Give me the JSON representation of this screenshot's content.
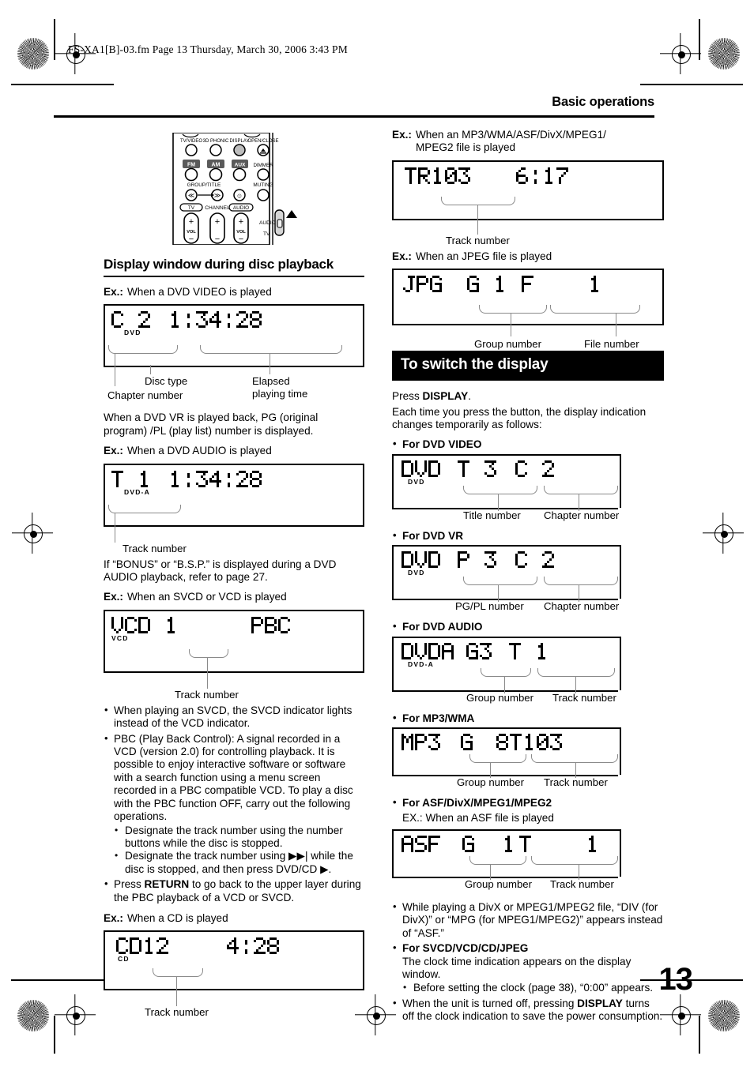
{
  "header": {
    "file_stamp": "FS-XA1[B]-03.fm  Page 13  Thursday, March 30, 2006  3:43 PM",
    "running_head": "Basic operations",
    "page_number": "13"
  },
  "remote": {
    "labels": [
      "TV/VIDEO",
      "3D PHONIC",
      "DISPLAY",
      "OPEN/CLOSE",
      "FM",
      "AM",
      "AUX",
      "DIMMER",
      "GROUP/TITLE",
      "MUTING",
      "TV",
      "CHANNEL",
      "AUDIO",
      "VOL",
      "VOL",
      "AUDIO",
      "TV"
    ]
  },
  "left": {
    "section_title": "Display window during disc playback",
    "ex_dvd_video": {
      "label": "Ex.:",
      "text": "When a DVD VIDEO is played"
    },
    "lcd_dvd_video": {
      "left_text": "C 2",
      "right_text": "1:34:28",
      "indicator": "DVD",
      "captions": [
        "Disc type",
        "Chapter number",
        "Elapsed",
        "playing time"
      ]
    },
    "para_dvdvr": "When a DVD VR is played back, PG (original program) /PL (play list) number is displayed.",
    "ex_dvd_audio": {
      "label": "Ex.:",
      "text": "When a DVD AUDIO is played"
    },
    "lcd_dvd_audio": {
      "left_text": "T 1",
      "right_text": "1:34:28",
      "indicator": "DVD-A",
      "caption": "Track number"
    },
    "para_bonus": "If “BONUS” or “B.S.P.” is displayed during a DVD AUDIO playback, refer to page 27.",
    "ex_svcd": {
      "label": "Ex.:",
      "text": "When an SVCD or VCD is played"
    },
    "lcd_vcd": {
      "left_text": "VCD 1",
      "right_text": "PBC",
      "indicator": "VCD",
      "caption": "Track number"
    },
    "bullets": [
      "When playing an SVCD, the SVCD indicator lights instead of the VCD indicator.",
      "PBC (Play Back Control): A signal recorded in a VCD (version 2.0) for controlling playback. It is possible to enjoy interactive software or software with a search function using a menu screen recorded in a PBC compatible VCD. To play a disc with the PBC function OFF, carry out the following operations."
    ],
    "sub_bullets": [
      "Designate the track number using the number buttons while the disc is stopped.",
      "Designate the track number using ▶▶| while the disc is stopped, and then press DVD/CD ▶."
    ],
    "bullet_return_prefix": "Press ",
    "bullet_return_bold": "RETURN",
    "bullet_return_suffix": " to go back to the upper layer during the PBC playback of a VCD or SVCD.",
    "ex_cd": {
      "label": "Ex.:",
      "text": "When a CD is played"
    },
    "lcd_cd": {
      "left_text": "CD12",
      "right_text": "4:28",
      "indicator": "CD",
      "caption": "Track number"
    }
  },
  "right": {
    "ex_mp3": {
      "label": "Ex.:",
      "line1": "When an MP3/WMA/ASF/DivX/MPEG1/",
      "line2": "MPEG2 file is played"
    },
    "lcd_mp3file": {
      "left_text": "TR103",
      "right_text": "6:17",
      "caption": "Track number"
    },
    "ex_jpeg": {
      "label": "Ex.:",
      "text": "When an JPEG file is played"
    },
    "lcd_jpeg": {
      "left_text": "JPG",
      "mid_text": "G 1",
      "right_text": "F    1",
      "captions": [
        "Group number",
        "File number"
      ]
    },
    "section_bar": "To switch the display",
    "press_prefix": "Press ",
    "press_bold": "DISPLAY",
    "press_suffix": ".",
    "press_para": "Each time you press the button, the display indication changes temporarily as follows:",
    "items": [
      {
        "heading": "For DVD VIDEO",
        "lcd": {
          "left_text": "DVD",
          "mid_text": "T 3",
          "right_text": "C 2",
          "indicator": "DVD"
        },
        "captions": [
          "Title number",
          "Chapter number"
        ]
      },
      {
        "heading": "For DVD VR",
        "lcd": {
          "left_text": "DVD",
          "mid_text": "P 3",
          "right_text": "C 2",
          "indicator": "DVD"
        },
        "captions": [
          "PG/PL number",
          "Chapter number"
        ]
      },
      {
        "heading": "For DVD AUDIO",
        "lcd": {
          "left_text": "DVDA",
          "mid_text": "G3",
          "right_text": "T 1",
          "indicator": "DVD-A"
        },
        "captions": [
          "Group number",
          "Track number"
        ]
      },
      {
        "heading": "For MP3/WMA",
        "lcd": {
          "left_text": "MP3",
          "mid_text": "G",
          "right_text": "8T103",
          "indicator": ""
        },
        "captions": [
          "Group number",
          "Track number"
        ]
      },
      {
        "heading": "For ASF/DivX/MPEG1/MPEG2",
        "sub_ex": "EX.: When an ASF file is played",
        "lcd": {
          "left_text": "ASF",
          "mid_text": "G  1",
          "right_text": "T    1",
          "indicator": ""
        },
        "captions": [
          "Group number",
          "Track number"
        ]
      }
    ],
    "tail_bullets": [
      "While playing a DivX or MPEG1/MPEG2 file, “DIV (for DivX)” or “MPG (for MPEG1/MPEG2)” appears instead of “ASF.”"
    ],
    "svcd_heading": "For SVCD/VCD/CD/JPEG",
    "svcd_text": "The clock time indication appears on the display window.",
    "svcd_sub": "Before setting the clock (page 38), “0:00” appears.",
    "off_prefix": "When the unit is turned off, pressing ",
    "off_bold": "DISPLAY",
    "off_suffix": " turns off the clock indication to save the power consumption."
  }
}
